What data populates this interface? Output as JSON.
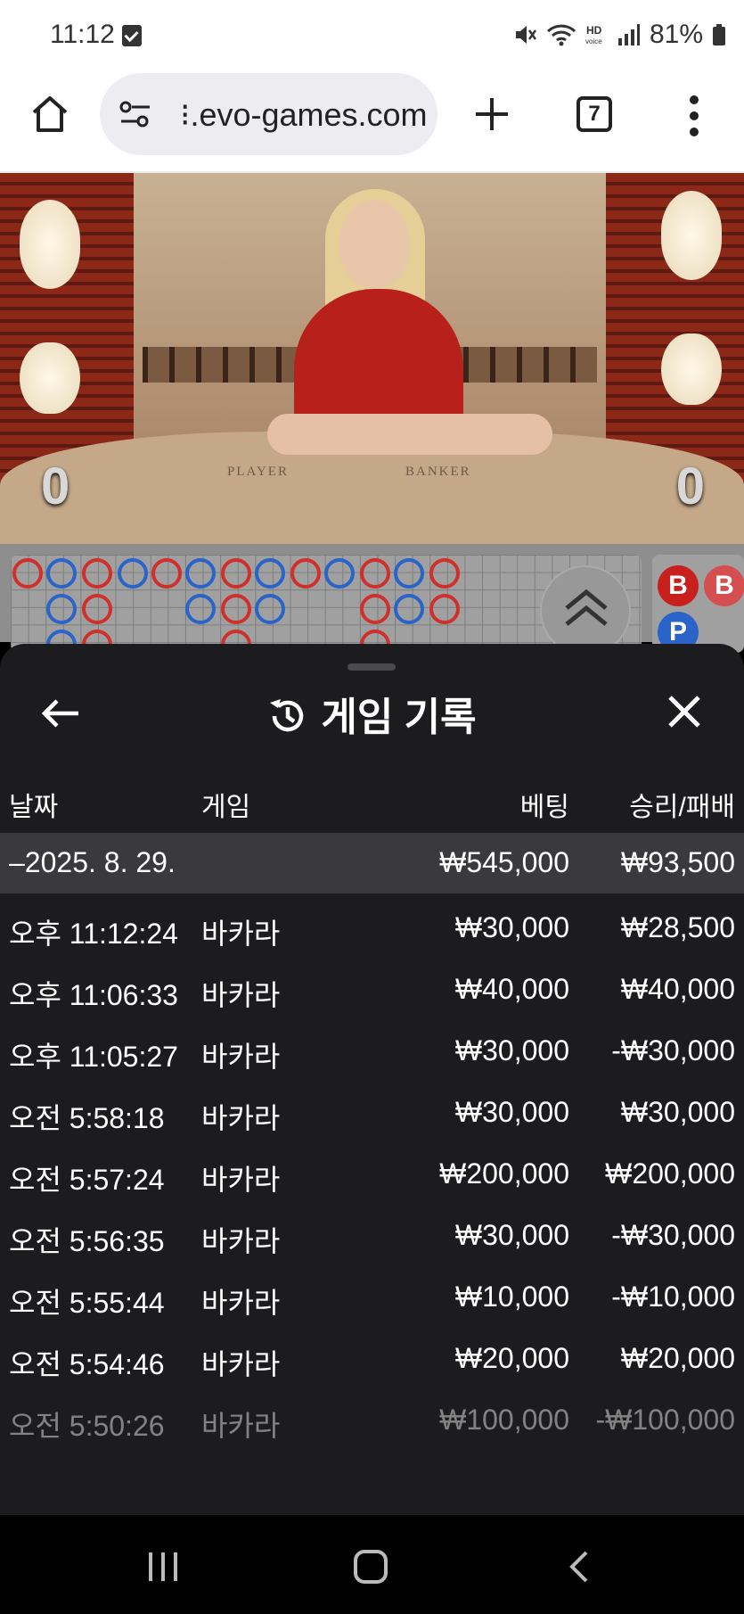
{
  "status_bar": {
    "time": "11:12",
    "battery": "81%"
  },
  "browser": {
    "url": "⁝.evo-games.com",
    "tab_count": "7"
  },
  "video": {
    "player_label": "PLAYER",
    "banker_label": "BANKER",
    "player_score": "0",
    "banker_score": "0"
  },
  "roadmap": {
    "b_label": "B",
    "p_label": "P"
  },
  "panel": {
    "title": "게임 기록",
    "columns": {
      "date": "날짜",
      "game": "게임",
      "bet": "베팅",
      "result": "승리/패배"
    },
    "date_group": {
      "date": "–2025. 8. 29.",
      "bet_total": "₩545,000",
      "result_total": "₩93,500"
    },
    "rows": [
      {
        "time": "오후 11:12:24",
        "game": "바카라",
        "bet": "₩30,000",
        "result": "₩28,500"
      },
      {
        "time": "오후 11:06:33",
        "game": "바카라",
        "bet": "₩40,000",
        "result": "₩40,000"
      },
      {
        "time": "오후 11:05:27",
        "game": "바카라",
        "bet": "₩30,000",
        "result": "-₩30,000"
      },
      {
        "time": "오전 5:58:18",
        "game": "바카라",
        "bet": "₩30,000",
        "result": "₩30,000"
      },
      {
        "time": "오전 5:57:24",
        "game": "바카라",
        "bet": "₩200,000",
        "result": "₩200,000"
      },
      {
        "time": "오전 5:56:35",
        "game": "바카라",
        "bet": "₩30,000",
        "result": "-₩30,000"
      },
      {
        "time": "오전 5:55:44",
        "game": "바카라",
        "bet": "₩10,000",
        "result": "-₩10,000"
      },
      {
        "time": "오전 5:54:46",
        "game": "바카라",
        "bet": "₩20,000",
        "result": "₩20,000"
      },
      {
        "time": "오전 5:50:26",
        "game": "바카라",
        "bet": "₩100,000",
        "result": "-₩100,000"
      }
    ]
  },
  "colors": {
    "banker_red": "#d0302c",
    "player_blue": "#2a64c8",
    "tie_green": "#2a8a3a",
    "panel_bg": "#1c1c1e"
  }
}
